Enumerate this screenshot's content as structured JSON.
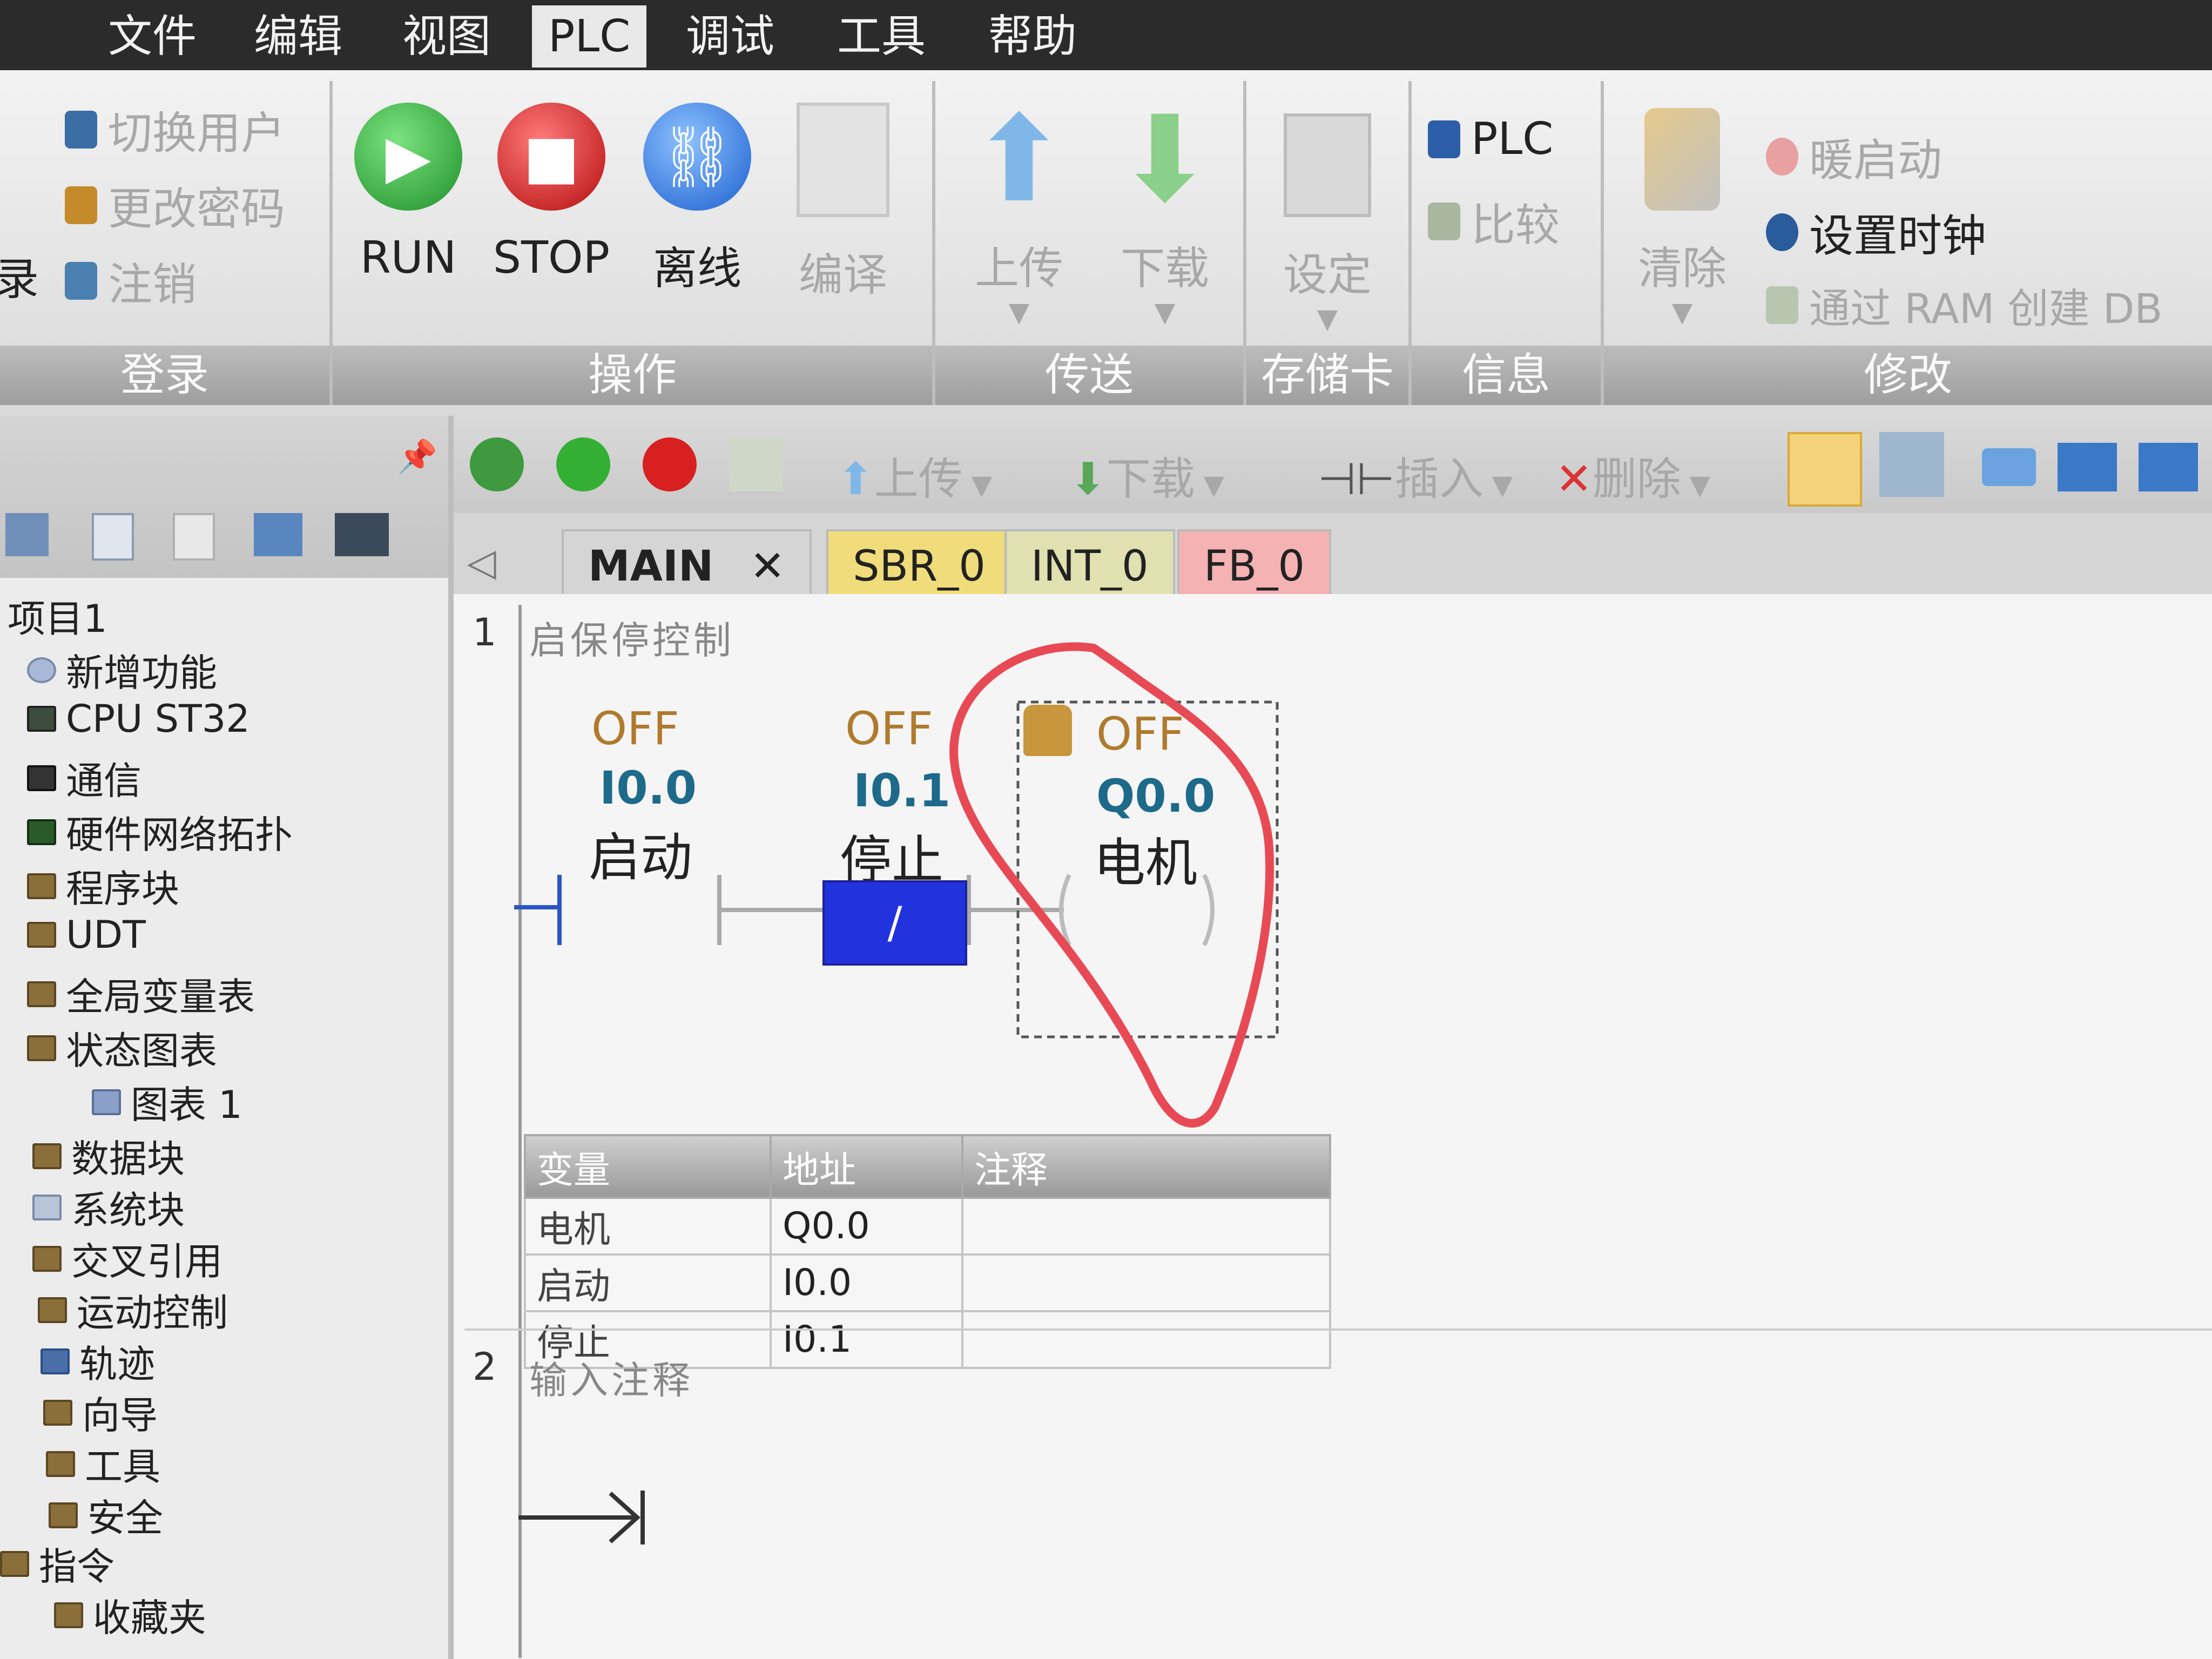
{
  "menu": [
    "文件",
    "编辑",
    "视图",
    "PLC",
    "调试",
    "工具",
    "帮助"
  ],
  "ribbon": {
    "login": {
      "label": "登录",
      "partial": "录",
      "items": [
        "切换用户",
        "更改密码",
        "注销"
      ]
    },
    "operate": {
      "label": "操作",
      "run": "RUN",
      "stop": "STOP",
      "offline": "离线",
      "compile": "编译"
    },
    "transfer": {
      "label": "传送",
      "upload": "上传",
      "download": "下载"
    },
    "card": {
      "label": "存储卡",
      "setting": "设定"
    },
    "info": {
      "label": "信息",
      "plc": "PLC",
      "compare": "比较"
    },
    "modify": {
      "label": "修改",
      "clear": "清除",
      "warm": "暖启动",
      "clock": "设置时钟",
      "ramdb": "通过 RAM 创建 DB"
    }
  },
  "tree": {
    "items": [
      "项目1",
      "新增功能",
      "CPU ST32",
      "通信",
      "硬件网络拓扑",
      "程序块",
      "UDT",
      "全局变量表",
      "状态图表",
      "图表 1",
      "数据块",
      "系统块",
      "交叉引用",
      "运动控制",
      "轨迹",
      "向导",
      "工具",
      "安全",
      "指令",
      "收藏夹"
    ]
  },
  "toolbar2": {
    "upload": "上传",
    "download": "下载",
    "insert": "插入",
    "delete": "删除"
  },
  "tabs": [
    {
      "label": "MAIN",
      "close": "✕",
      "color": "#d5d5d5"
    },
    {
      "label": "SBR_0",
      "color": "#f0dc7a"
    },
    {
      "label": "INT_0",
      "color": "#e0e0b0"
    },
    {
      "label": "FB_0",
      "color": "#f4b2b2"
    }
  ],
  "rungs": [
    {
      "number": "1",
      "comment": "启保停控制",
      "contacts": [
        {
          "state": "OFF",
          "address": "I0.0",
          "name": "启动"
        },
        {
          "state": "OFF",
          "address": "I0.1",
          "name": "停止",
          "symbol": "/"
        }
      ],
      "coil": {
        "state": "OFF",
        "address": "Q0.0",
        "name": "电机"
      }
    },
    {
      "number": "2",
      "comment": "输入注释"
    }
  ],
  "var_table": {
    "headers": [
      "变量",
      "地址",
      "注释"
    ],
    "rows": [
      [
        "电机",
        "Q0.0",
        ""
      ],
      [
        "启动",
        "I0.0",
        ""
      ],
      [
        "停止",
        "I0.1",
        ""
      ]
    ]
  },
  "colors": {
    "run": "#2fae3a",
    "stop": "#d61f1f",
    "offline": "#2f7fe0",
    "annotation": "#e84a55",
    "nc_contact": "#2233dd"
  }
}
